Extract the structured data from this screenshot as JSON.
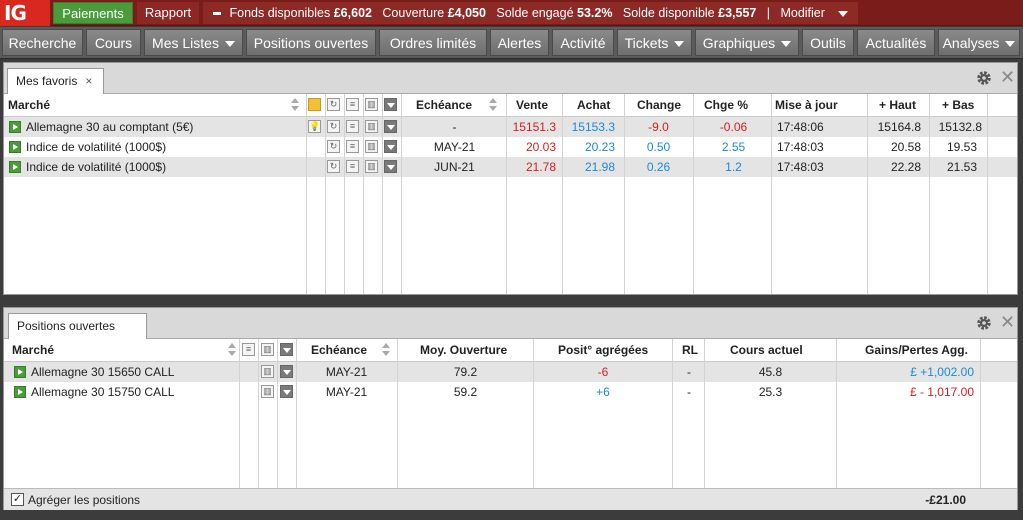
{
  "topbar": {
    "logo": "IG",
    "paiements": "Paiements",
    "rapport": "Rapport",
    "fonds_label": "Fonds disponibles",
    "fonds_value": "£6,602",
    "couverture_label": "Couverture",
    "couverture_value": "£4,050",
    "solde_engage_label": "Solde engagé",
    "solde_engage_value": "53.2%",
    "solde_dispo_label": "Solde disponible",
    "solde_dispo_value": "£3,557",
    "separator": "|",
    "modifier": "Modifier"
  },
  "nav": {
    "items": [
      {
        "label": "Recherche"
      },
      {
        "label": "Cours"
      },
      {
        "label": "Mes Listes"
      },
      {
        "label": "Positions ouvertes"
      },
      {
        "label": "Ordres limités"
      },
      {
        "label": "Alertes"
      },
      {
        "label": "Activité"
      },
      {
        "label": "Tickets"
      },
      {
        "label": "Graphiques"
      },
      {
        "label": "Outils"
      },
      {
        "label": "Actualités"
      },
      {
        "label": "Analyses"
      }
    ]
  },
  "favoris": {
    "tab": "Mes favoris",
    "tab_close": "×",
    "close": "✕",
    "headers": {
      "marche": "Marché",
      "echeance": "Echéance",
      "vente": "Vente",
      "achat": "Achat",
      "change": "Change",
      "chge": "Chge %",
      "mise": "Mise à jour",
      "haut": "+ Haut",
      "bas": "+ Bas"
    },
    "rows": [
      {
        "marche": "Allemagne 30 au comptant (5€)",
        "echeance": "-",
        "vente": "15151.3",
        "achat": "15153.3",
        "change": "-9.0",
        "chge": "-0.06",
        "mise": "17:48:06",
        "haut": "15164.8",
        "bas": "15132.8"
      },
      {
        "marche": "Indice de volatilité (1000$)",
        "echeance": "MAY-21",
        "vente": "20.03",
        "achat": "20.23",
        "change": "0.50",
        "chge": "2.55",
        "mise": "17:48:03",
        "haut": "20.58",
        "bas": "19.53"
      },
      {
        "marche": "Indice de volatilité (1000$)",
        "echeance": "JUN-21",
        "vente": "21.78",
        "achat": "21.98",
        "change": "0.26",
        "chge": "1.2",
        "mise": "17:48:03",
        "haut": "22.28",
        "bas": "21.53"
      }
    ]
  },
  "positions": {
    "tab": "Positions ouvertes",
    "close": "✕",
    "headers": {
      "marche": "Marché",
      "echeance": "Echéance",
      "moy": "Moy. Ouverture",
      "posit": "Posit° agrégées",
      "rl": "RL",
      "cours": "Cours actuel",
      "gains": "Gains/Pertes Agg."
    },
    "rows": [
      {
        "marche": "Allemagne 30 15650 CALL",
        "echeance": "MAY-21",
        "moy": "79.2",
        "posit": "-6",
        "rl": "-",
        "cours": "45.8",
        "gains": "£ +1,002.00"
      },
      {
        "marche": "Allemagne 30 15750 CALL",
        "echeance": "MAY-21",
        "moy": "59.2",
        "posit": "+6",
        "rl": "-",
        "cours": "25.3",
        "gains": "£ - 1,017.00"
      }
    ],
    "agreger": "Agréger les positions",
    "agreger_check": "✓",
    "total": "-£21.00"
  }
}
